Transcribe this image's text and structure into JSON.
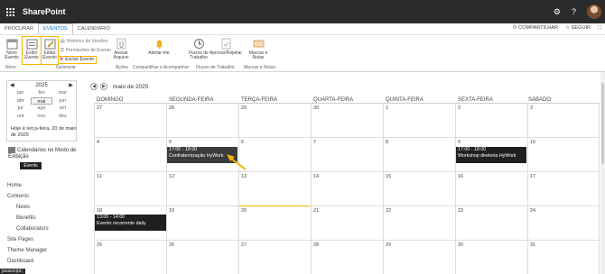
{
  "suite": {
    "app_name": "SharePoint"
  },
  "ribbon_tabs": [
    "PROCURAR",
    "EVENTOS",
    "CALENDÁRIO"
  ],
  "ribbon_right": {
    "share": "COMPARTILHAR",
    "follow": "SEGUIR"
  },
  "ribbon": {
    "new_event": "Novo Evento",
    "view_event": "Exibir Evento",
    "edit_event": "Editar Evento",
    "version_history": "Histórico de Versões",
    "permissions": "Permissões de Evento",
    "delete_event": "Excluir Evento",
    "attach_file": "Anexar Arquivo",
    "alert_me": "Alertar-me",
    "workflow": "Fluxos de Trabalho",
    "approve_reject": "Aprovar/Rejeitar",
    "tags_notes": "Marcas e Notas",
    "groups": {
      "new": "Novo",
      "manage": "Gerenciar",
      "actions": "Ações",
      "share_track": "Compartilhar e Acompanhar",
      "workflows": "Fluxos de Trabalho",
      "tags_notes": "Marcas e Notas"
    }
  },
  "datepicker": {
    "year": "2025",
    "months": [
      "jan",
      "fev",
      "mar",
      "abr",
      "mai",
      "jun",
      "jul",
      "ago",
      "set",
      "out",
      "nov",
      "dez"
    ],
    "selected": "mai",
    "today_text": "Hoje é terça-feira, 20 de maio de 2025"
  },
  "overlay": {
    "label": "Calendários no Modo de Exibição",
    "chip": "Events"
  },
  "leftnav": [
    "Home",
    "Contents",
    "News",
    "Benefits",
    "Collaborators",
    "Site Pages",
    "Theme Manager",
    "Dashboard"
  ],
  "status_tip": "javascript:;",
  "calendar": {
    "title": "maio de 2025",
    "weekdays": [
      "DOMINGO",
      "SEGUNDA-FEIRA",
      "TERÇA-FEIRA",
      "QUARTA-FEIRA",
      "QUINTA-FEIRA",
      "SEXTA-FEIRA",
      "SÁBADO"
    ],
    "weeks": [
      [
        "27",
        "28",
        "29",
        "30",
        "1",
        "2",
        "3"
      ],
      [
        "4",
        "5",
        "6",
        "7",
        "8",
        "9",
        "10"
      ],
      [
        "11",
        "12",
        "13",
        "14",
        "15",
        "16",
        "17"
      ],
      [
        "18",
        "19",
        "20",
        "21",
        "22",
        "23",
        "24"
      ],
      [
        "25",
        "26",
        "27",
        "28",
        "29",
        "30",
        "31"
      ]
    ],
    "events": {
      "e1_time": "17:00 - 18:00",
      "e1_title": "Confraternização HyWork",
      "e2_time": "17:00 - 18:00",
      "e2_title": "Workshop diretoria HyWork",
      "e3_time": "13:00 - 14:00",
      "e3_title": "Evento recorrente daily"
    }
  },
  "colors": {
    "accent": "#0078d4",
    "highlight": "#f4b400",
    "event_bg": "#1f1f1f"
  }
}
